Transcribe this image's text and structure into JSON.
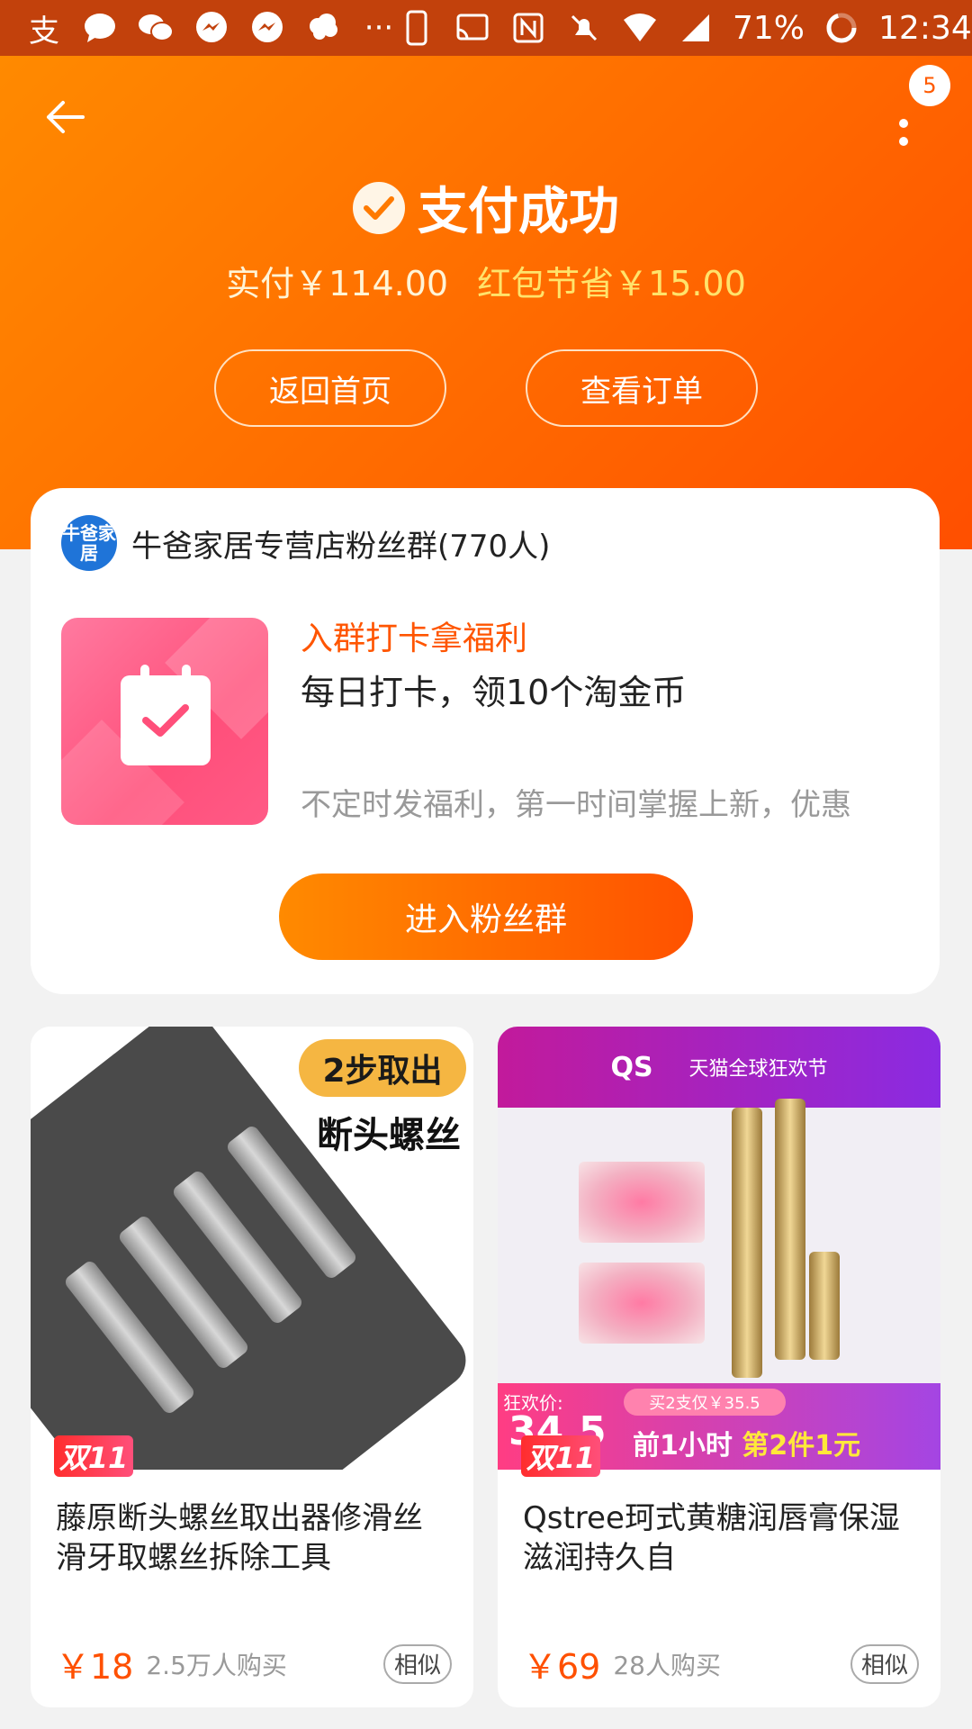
{
  "status_bar": {
    "left_icons": [
      "alipay-icon",
      "message-icon",
      "wechat-icon",
      "messenger-icon",
      "messenger-icon",
      "cloud-icon",
      "more-icon"
    ],
    "right_icons": [
      "phone-icon",
      "cast-icon",
      "nfc-icon",
      "mute-icon",
      "wifi-icon",
      "signal-icon"
    ],
    "battery": "71%",
    "time": "12:34"
  },
  "header": {
    "title": "支付成功",
    "paid": "实付￥114.00",
    "saved": "红包节省￥15.00",
    "badge_count": "5",
    "buttons": {
      "home": "返回首页",
      "order": "查看订单"
    },
    "colors": {
      "gradient_start": "#ff8a00",
      "gradient_end": "#ff4f00"
    }
  },
  "fan_group": {
    "shop_logo": "牛爸家居",
    "name": "牛爸家居专营店粉丝群(770人)",
    "perk_title": "入群打卡拿福利",
    "perk_desc": "每日打卡，领10个淘金币",
    "note": "不定时发福利，第一时间掌握上新，优惠",
    "join_button": "进入粉丝群"
  },
  "products": [
    {
      "image_tag_top": "2步取出",
      "image_tag_bottom": "断头螺丝",
      "badge": "双11",
      "title": "藤原断头螺丝取出器修滑丝滑牙取螺丝拆除工具",
      "price": "￥18",
      "sales": "2.5万人购买",
      "similar": "相似"
    },
    {
      "image_brand": "QS",
      "image_event": "天猫全球狂欢节",
      "promo_label": "狂欢价:",
      "promo_price": "34.5",
      "promo_small": "买2支仅￥35.5",
      "promo_main_prefix": "前1小时 ",
      "promo_main_highlight": "第2件1元",
      "badge": "双11",
      "title": "Qstree珂式黄糖润唇膏保湿滋润持久自",
      "price": "￥69",
      "sales": "28人购买",
      "similar": "相似"
    }
  ]
}
